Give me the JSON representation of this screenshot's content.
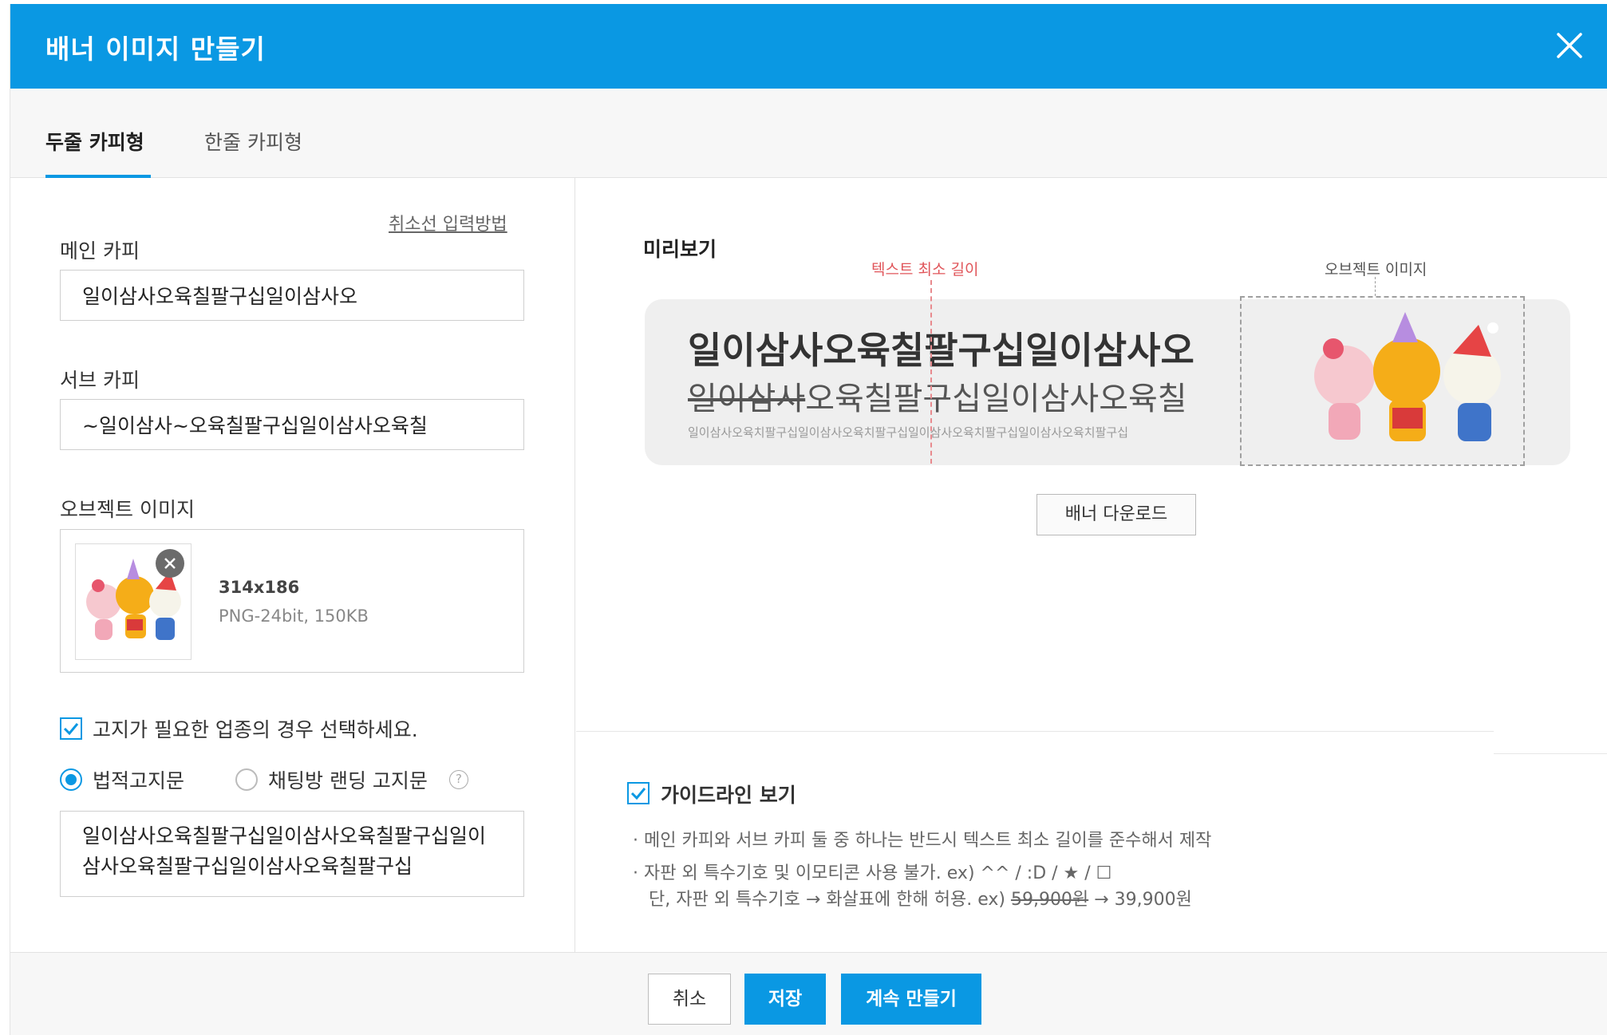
{
  "header": {
    "title": "배너 이미지 만들기"
  },
  "tabs": [
    {
      "label": "두줄 카피형"
    },
    {
      "label": "한줄 카피형"
    }
  ],
  "form": {
    "strike_link": "취소선 입력방법",
    "main_copy_label": "메인 카피",
    "main_copy_value": "일이삼사오육칠팔구십일이삼사오",
    "sub_copy_label": "서브 카피",
    "sub_copy_value": "~일이삼사~오육칠팔구십일이삼사오육칠",
    "object_image_label": "오브젝트 이미지",
    "object_image": {
      "size": "314x186",
      "format": "PNG-24bit, 150KB"
    },
    "notice_check_label": "고지가 필요한 업종의 경우 선택하세요.",
    "radio_legal": "법적고지문",
    "radio_chat": "채팅방 랜딩 고지문",
    "help_glyph": "?",
    "notice_text": "일이삼사오육칠팔구십일이삼사오육칠팔구십일이삼사오육칠팔구십일이삼사오육칠팔구십"
  },
  "preview": {
    "label": "미리보기",
    "guide_text_min": "텍스트 최소 길이",
    "guide_object": "오브젝트 이미지",
    "banner_main": "일이삼사오육칠팔구십일이삼사오",
    "banner_sub_strike": "일이삼사",
    "banner_sub_rest": "오육칠팔구십일이삼사오육칠",
    "banner_notice": "일이삼사오육치팔구십일이삼사오육치팔구십일이삼사오육치팔구십일이삼사오육치팔구십",
    "download_label": "배너 다운로드"
  },
  "guide": {
    "checkbox_label": "가이드라인 보기",
    "line1": "· 메인 카피와 서브 카피 둘 중 하나는 반드시 텍스트 최소 길이를 준수해서 제작",
    "line2": "· 자판 외 특수기호 및 이모티콘 사용 불가. ex) ^^ / :D / ★ / ☐",
    "line3_pre": "단, 자판 외 특수기호 → 화살표에 한해 허용. ex) ",
    "line3_strike": "59,900원",
    "line3_post": " → 39,900원"
  },
  "footer": {
    "cancel": "취소",
    "save": "저장",
    "continue": "계속 만들기"
  },
  "colors": {
    "accent": "#0a98e3",
    "guide_red": "#e0555a"
  },
  "icons": {
    "close": "close-icon",
    "check": "check-icon",
    "help": "help-icon",
    "remove": "remove-icon"
  }
}
